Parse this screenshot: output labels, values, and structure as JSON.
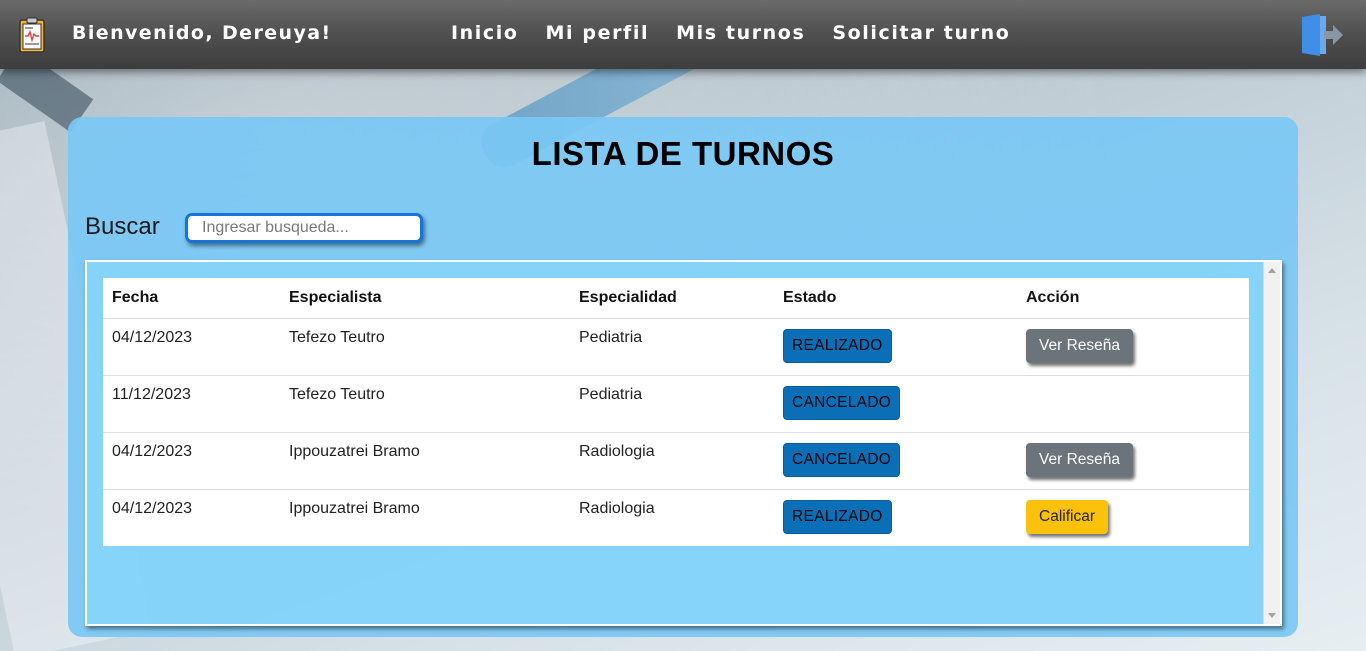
{
  "header": {
    "welcome": "Bienvenido, Dereuya!",
    "nav": [
      {
        "label": "Inicio"
      },
      {
        "label": "Mi perfil"
      },
      {
        "label": "Mis turnos"
      },
      {
        "label": "Solicitar turno"
      }
    ],
    "brand_icon": "clipboard-icon",
    "logout_icon": "logout-icon"
  },
  "main": {
    "title": "LISTA DE TURNOS",
    "search": {
      "label": "Buscar",
      "placeholder": "Ingresar busqueda...",
      "value": ""
    },
    "table": {
      "columns": [
        "Fecha",
        "Especialista",
        "Especialidad",
        "Estado",
        "Acción"
      ],
      "rows": [
        {
          "fecha": "04/12/2023",
          "especialista": "Tefezo Teutro",
          "especialidad": "Pediatria",
          "estado": "REALIZADO",
          "accion": "Ver Reseña",
          "accion_style": "grey"
        },
        {
          "fecha": "11/12/2023",
          "especialista": "Tefezo Teutro",
          "especialidad": "Pediatria",
          "estado": "CANCELADO",
          "accion": "",
          "accion_style": ""
        },
        {
          "fecha": "04/12/2023",
          "especialista": "Ippouzatrei Bramo",
          "especialidad": "Radiologia",
          "estado": "CANCELADO",
          "accion": "Ver Reseña",
          "accion_style": "grey"
        },
        {
          "fecha": "04/12/2023",
          "especialista": "Ippouzatrei Bramo",
          "especialidad": "Radiologia",
          "estado": "REALIZADO",
          "accion": "Calificar",
          "accion_style": "yellow"
        }
      ]
    }
  },
  "colors": {
    "navbar": "#4d4d4d",
    "card": "#78c8f5",
    "badge": "#0b6fb8",
    "btn_grey": "#6b737b",
    "btn_yellow": "#fbc10b",
    "input_border": "#1673d9"
  }
}
